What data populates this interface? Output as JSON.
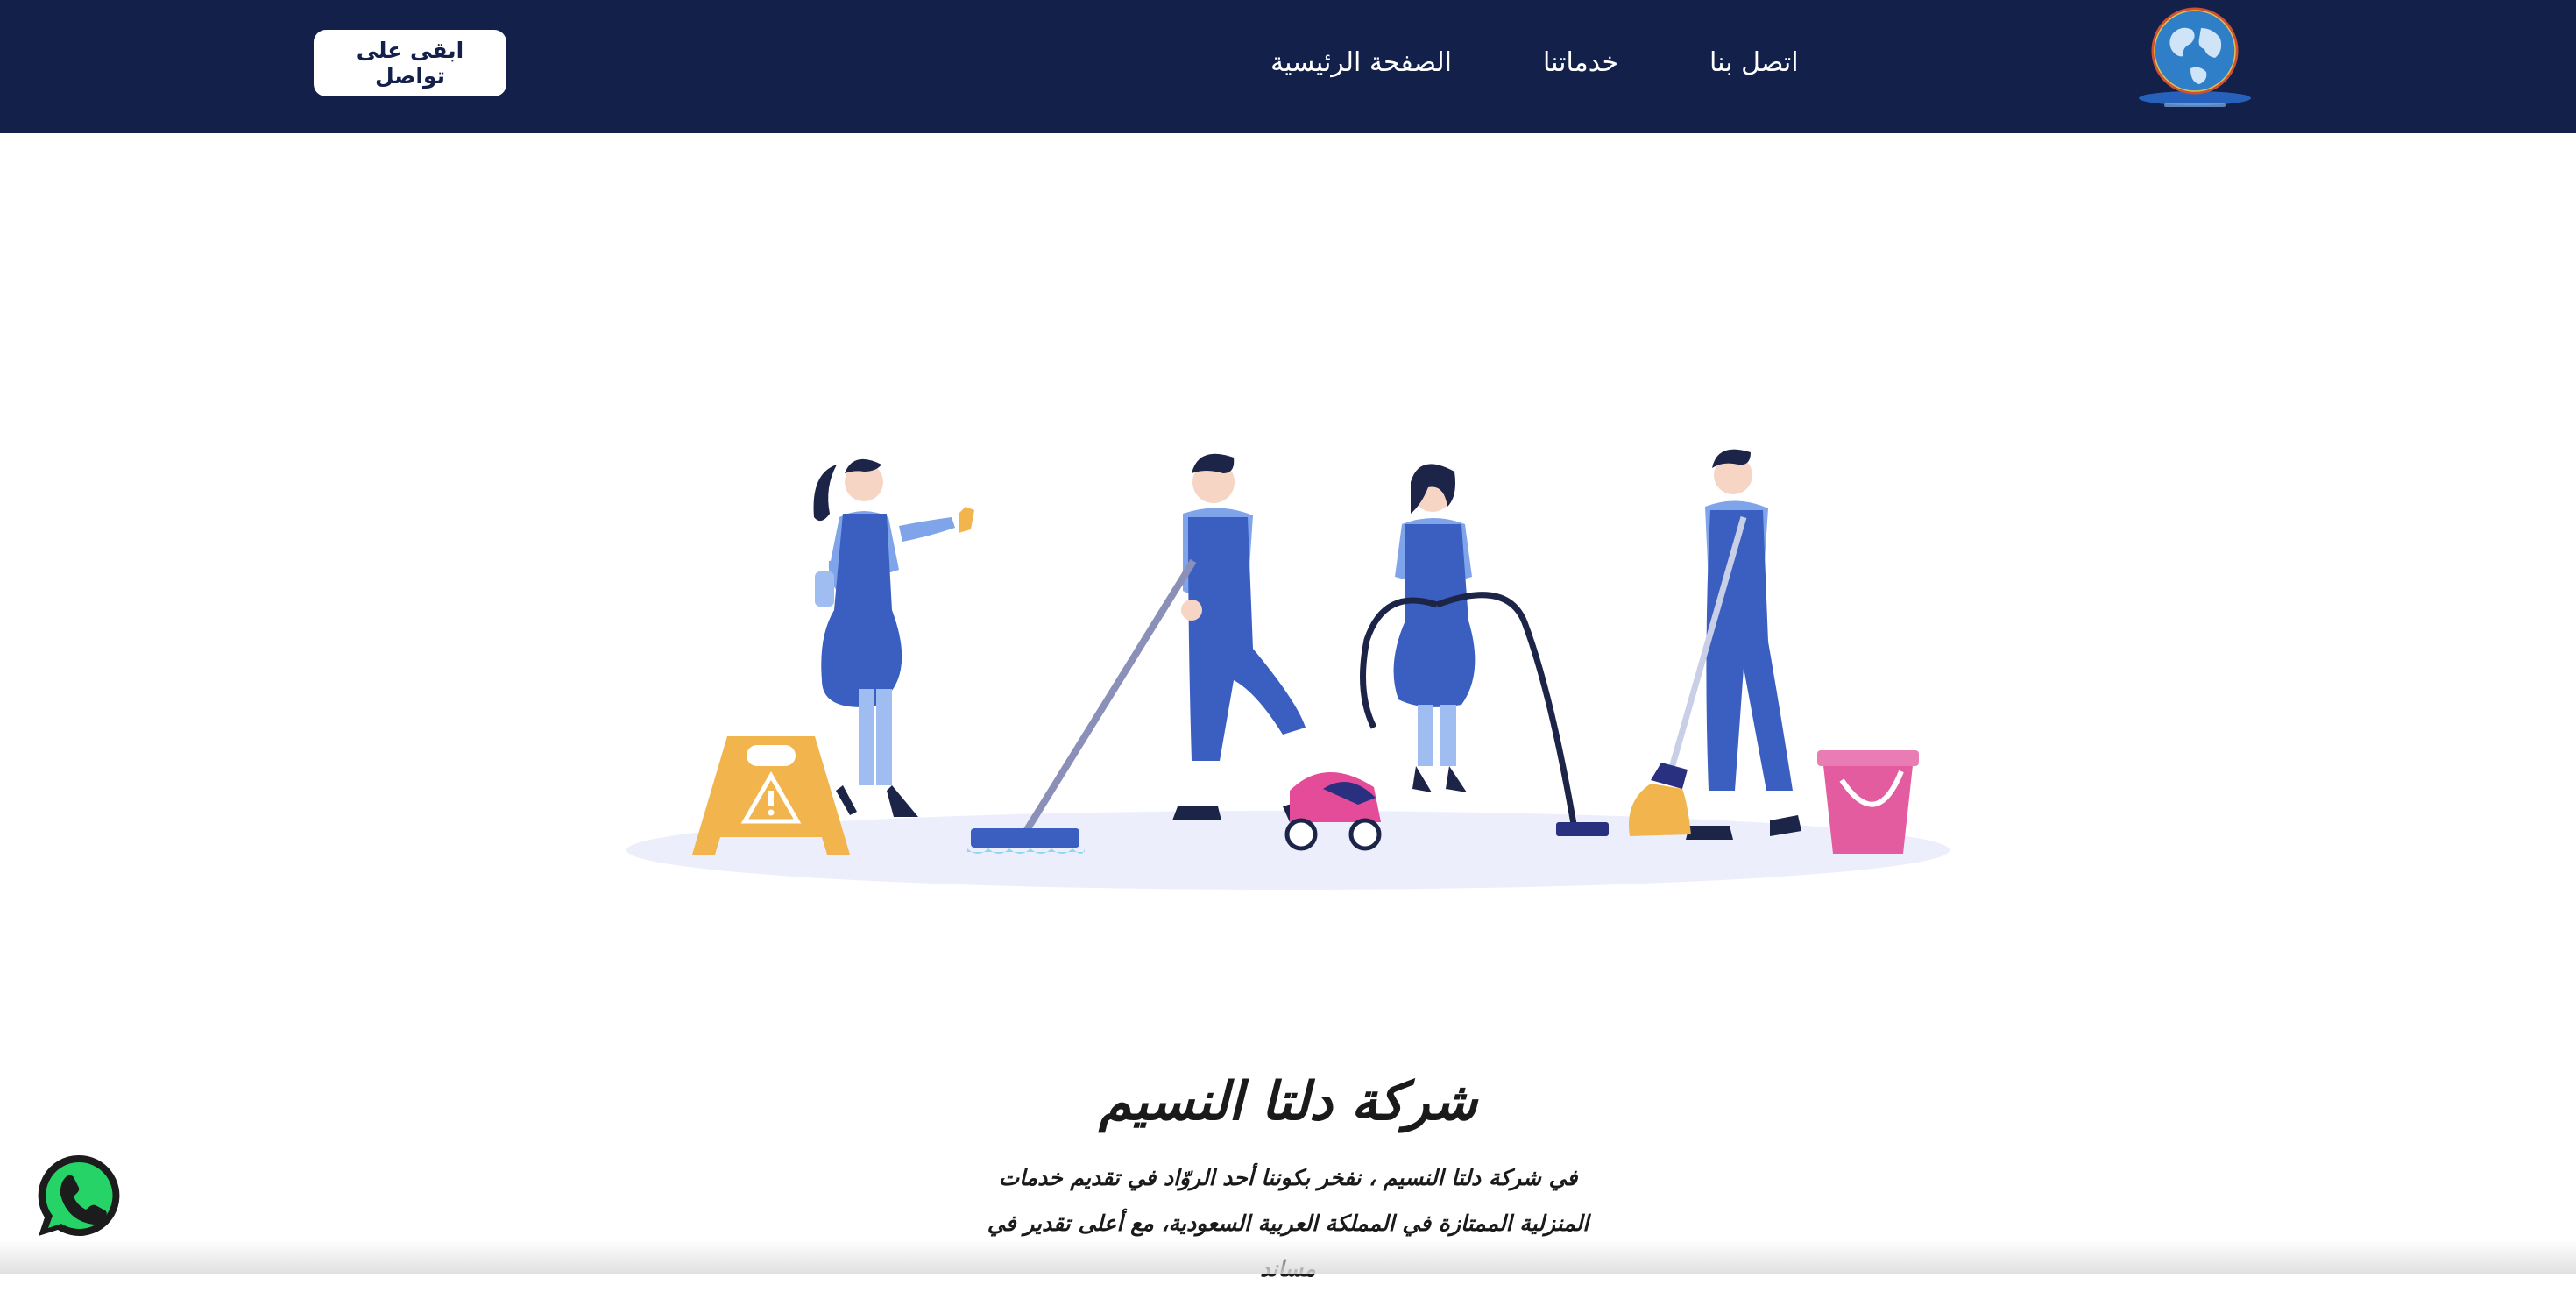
{
  "nav": {
    "links": [
      {
        "label": "الصفحة الرئيسية"
      },
      {
        "label": "خدماتنا"
      },
      {
        "label": "اتصل بنا"
      }
    ],
    "cta_label": "ابقى على تواصل"
  },
  "hero": {
    "illustration": "cleaning-team-illustration"
  },
  "content": {
    "title": "شركة دلتا النسيم",
    "intro": "في شركة دلتا النسيم ، نفخر بكوننا أحد الروّاد في تقديم خدمات المنزلية الممتازة في المملكة العربية السعودية، مع أعلى تقدير في مساند"
  },
  "colors": {
    "navbar": "#13204a",
    "uniform": "#3a5fc0",
    "shirt": "#7fa4ea",
    "sign": "#f2b44c",
    "vacuum": "#e44c9a",
    "whatsapp": "#25d366"
  },
  "icons": {
    "logo": "globe-logo",
    "whatsapp": "whatsapp-icon"
  }
}
